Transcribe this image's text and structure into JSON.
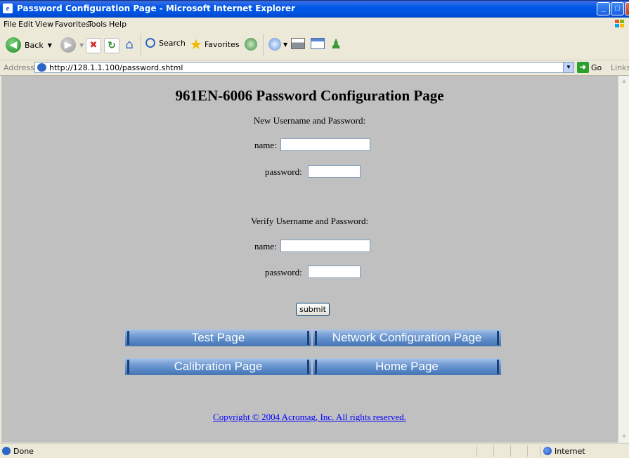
{
  "window": {
    "title": "Password Configuration Page - Microsoft Internet Explorer",
    "controls": {
      "min": "_",
      "max": "□",
      "close": "X"
    }
  },
  "menu": [
    "File",
    "Edit",
    "View",
    "Favorites",
    "Tools",
    "Help"
  ],
  "toolbar": {
    "back_label": "Back",
    "search_label": "Search",
    "favorites_label": "Favorites",
    "icons": [
      "back-icon",
      "forward-icon",
      "stop-icon",
      "refresh-icon",
      "home-icon",
      "search-icon",
      "favorites-icon",
      "history-icon",
      "mail-icon",
      "print-icon",
      "edit-icon",
      "messenger-icon"
    ]
  },
  "address": {
    "label": "Address",
    "url": "http://128.1.1.100/password.shtml",
    "go_label": "Go",
    "links_label": "Links"
  },
  "page": {
    "heading": "961EN-6006 Password Configuration Page",
    "new_section": "New Username and Password:",
    "verify_section": "Verify Username and Password:",
    "name_label": "name:",
    "password_label": "password:",
    "submit_label": "submit",
    "nav": {
      "test": "Test Page",
      "network": "Network Configuration Page",
      "calibration": "Calibration Page",
      "home": "Home Page"
    },
    "copyright": "Copyright © 2004 Acromag, Inc. All rights reserved."
  },
  "status": {
    "text": "Done",
    "zone": "Internet"
  },
  "colors": {
    "content_bg": "#c0c0c0",
    "nav_button": "#5d8cc8",
    "link": "#0000ff",
    "titlebar": "#0054e3"
  }
}
